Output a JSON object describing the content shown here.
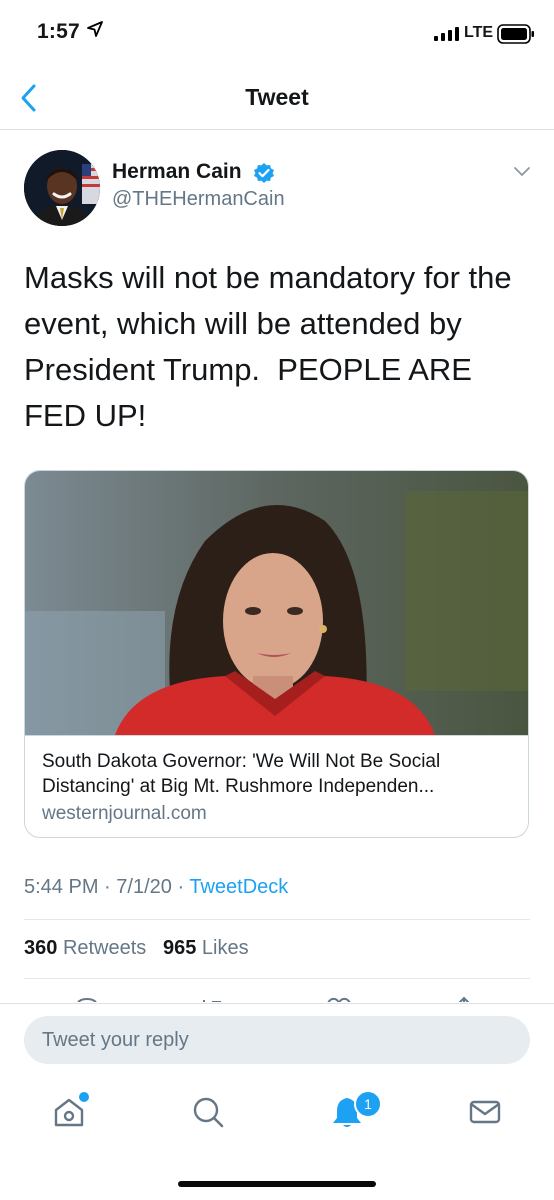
{
  "status_bar": {
    "time": "1:57",
    "network": "LTE",
    "icons": [
      "location-arrow-icon",
      "signal-icon",
      "battery-icon"
    ]
  },
  "nav": {
    "title": "Tweet",
    "back_icon": "chevron-left-icon"
  },
  "tweet": {
    "author_name": "Herman Cain",
    "author_handle": "@THEHermanCain",
    "verified": true,
    "text": "Masks will not be mandatory for the event, which will be attended by President Trump.  PEOPLE ARE FED UP!",
    "card": {
      "title": "South Dakota Governor: 'We Will Not Be Social Distancing' at Big Mt. Rushmore Independen...",
      "domain": "westernjournal.com"
    },
    "meta": {
      "time": "5:44 PM",
      "date": "7/1/20",
      "separator": "·",
      "source": "TweetDeck"
    },
    "stats": {
      "retweets_count": "360",
      "retweets_label": "Retweets",
      "likes_count": "965",
      "likes_label": "Likes"
    }
  },
  "reply": {
    "placeholder": "Tweet your reply"
  },
  "tab_bar": {
    "items": [
      "home-icon",
      "search-icon",
      "notifications-icon",
      "messages-icon"
    ],
    "notification_badge": "1"
  },
  "colors": {
    "accent": "#1da1f2",
    "text": "#14171a",
    "secondary": "#657786",
    "border": "#e1e8ed"
  }
}
